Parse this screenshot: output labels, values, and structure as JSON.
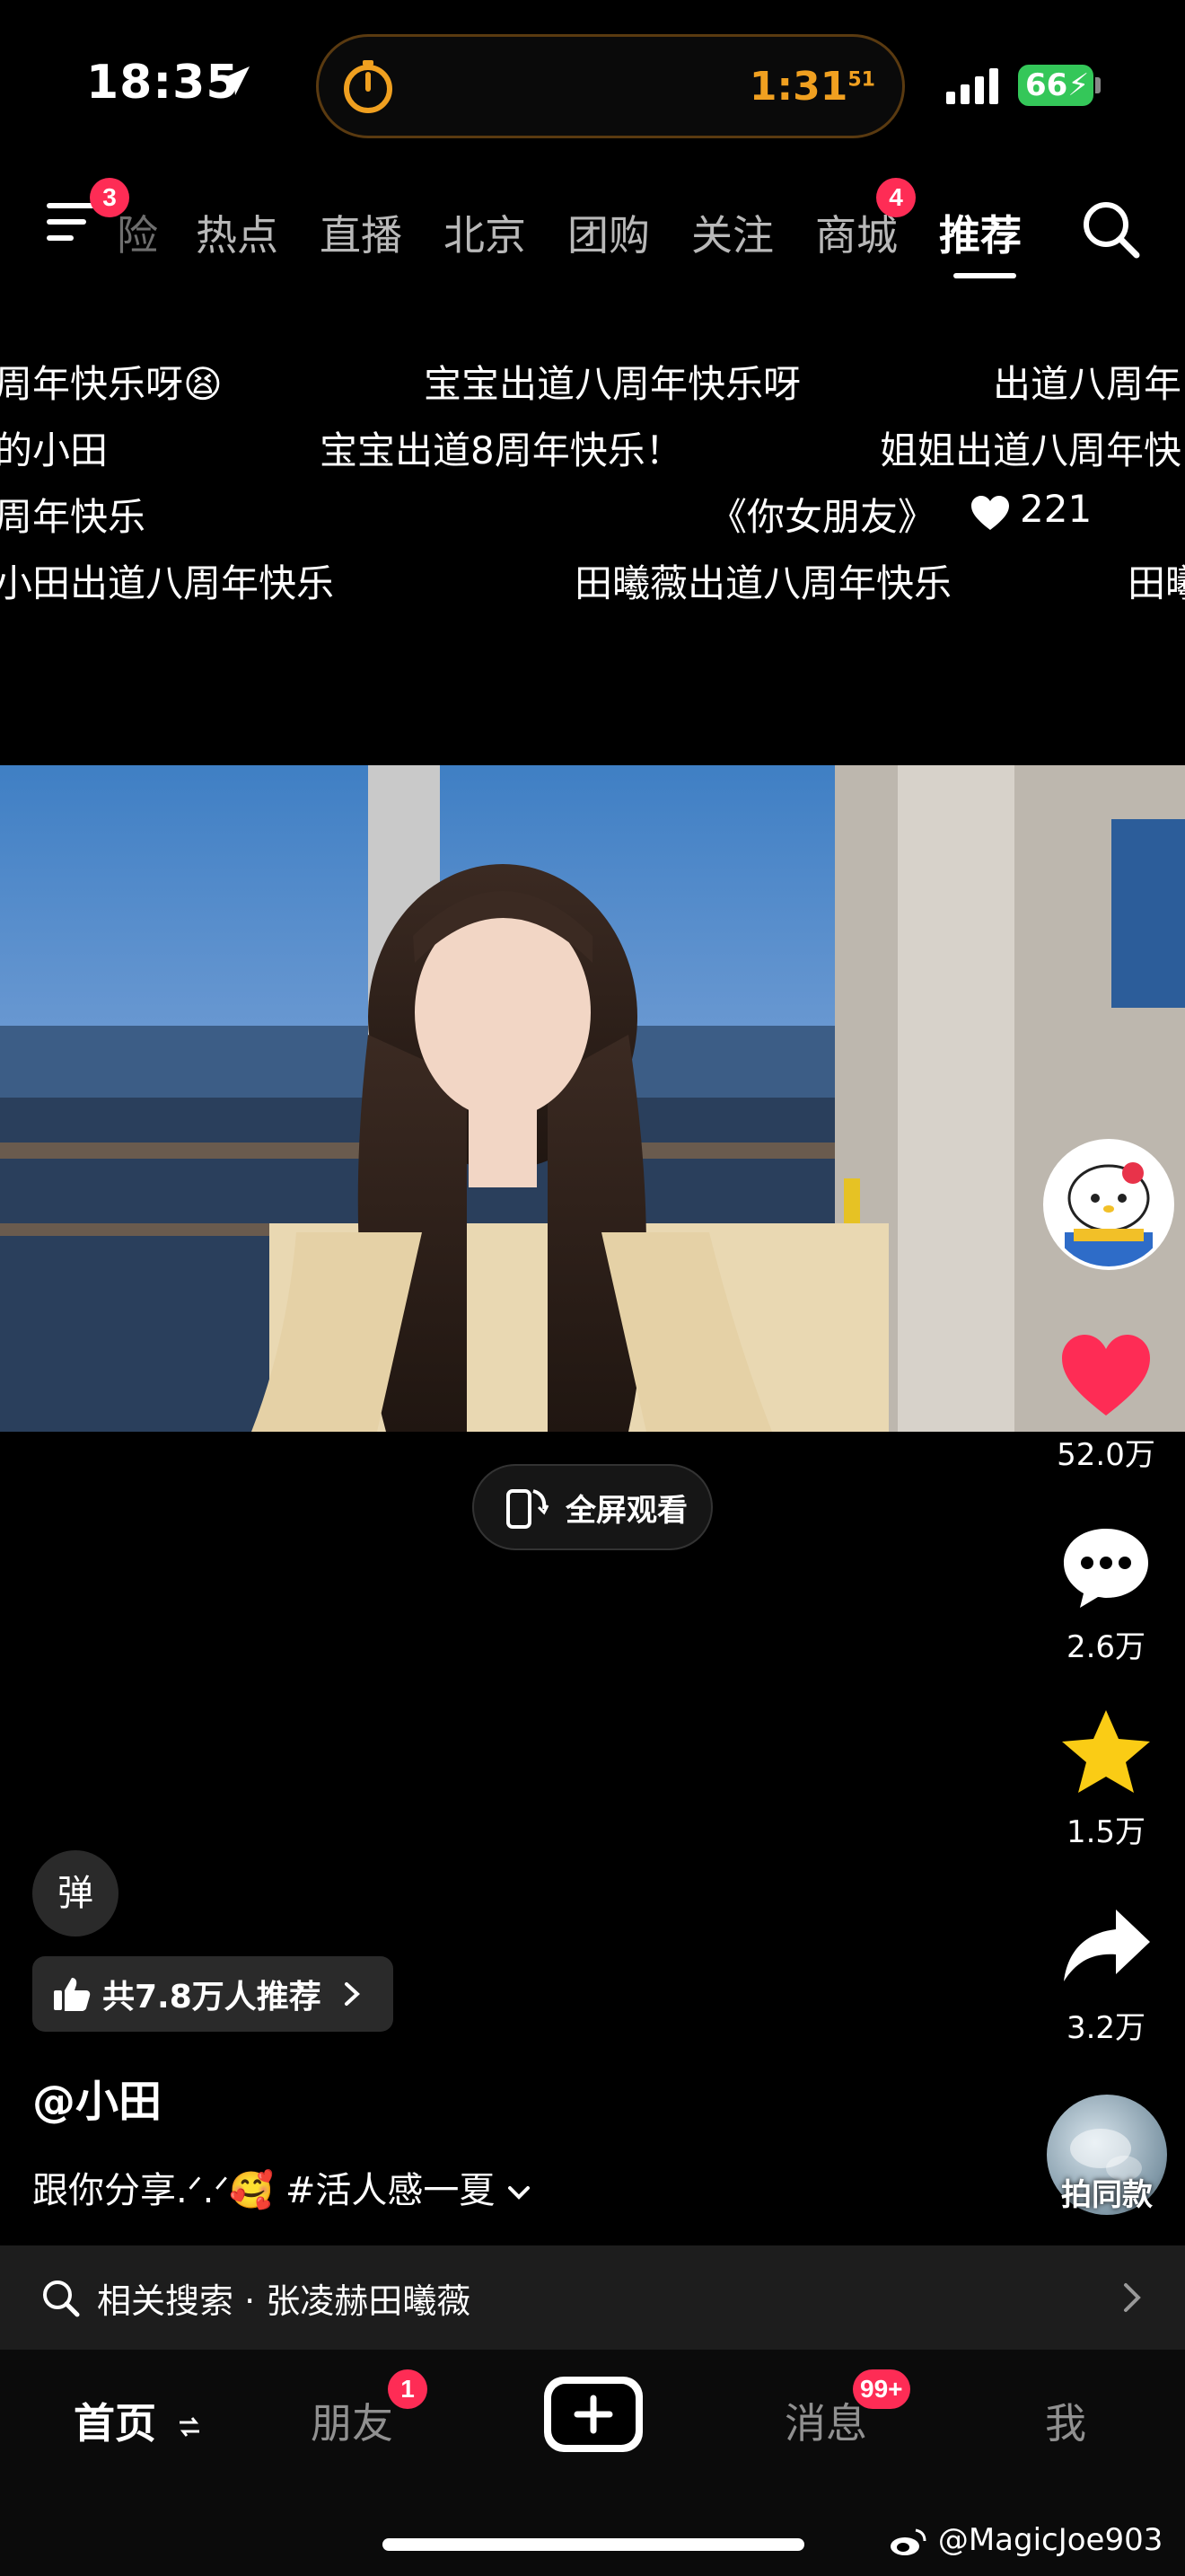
{
  "status_bar": {
    "time": "18:35",
    "timer": "1:31",
    "timer_seconds": "51",
    "battery": "66",
    "accent_timer_color": "#f0a020",
    "battery_color": "#34c759"
  },
  "top_nav": {
    "menu_badge": "3",
    "tabs": [
      "险",
      "热点",
      "直播",
      "北京",
      "团购",
      "关注",
      "商城",
      "推荐"
    ],
    "mall_badge": "4",
    "active_tab": "推荐"
  },
  "danmaku": [
    {
      "text": "周年快乐呀😫"
    },
    {
      "text": "宝宝出道八周年快乐呀"
    },
    {
      "text": "出道八周年"
    },
    {
      "text": "的小田"
    },
    {
      "text": "宝宝出道8周年快乐！"
    },
    {
      "text": "姐姐出道八周年快"
    },
    {
      "text": "周年快乐"
    },
    {
      "text": "《你女朋友》"
    },
    {
      "text": "221"
    },
    {
      "text": "小田出道八周年快乐"
    },
    {
      "text": "田曦薇出道八周年快乐"
    },
    {
      "text": "田曦"
    }
  ],
  "fullscreen": {
    "label": "全屏观看"
  },
  "rail": {
    "likes": "52.0万",
    "comments": "2.6万",
    "favorites": "1.5万",
    "shares": "3.2万",
    "like_color": "#fe2c55",
    "favorite_color": "#facc15"
  },
  "info": {
    "danmu_toggle": "弹",
    "recommend": "共7.8万人推荐",
    "author": "@小田",
    "caption": "跟你分享.ᐟ.ᐟ🥰 #活人感一夏",
    "same_style": "拍同款"
  },
  "related_search": {
    "label": "相关搜索 · 张凌赫田曦薇"
  },
  "tabbar": {
    "home": "首页",
    "friends": "朋友",
    "friends_badge": "1",
    "messages": "消息",
    "messages_badge": "99+",
    "me": "我"
  },
  "watermark": "@MagicJoe903"
}
